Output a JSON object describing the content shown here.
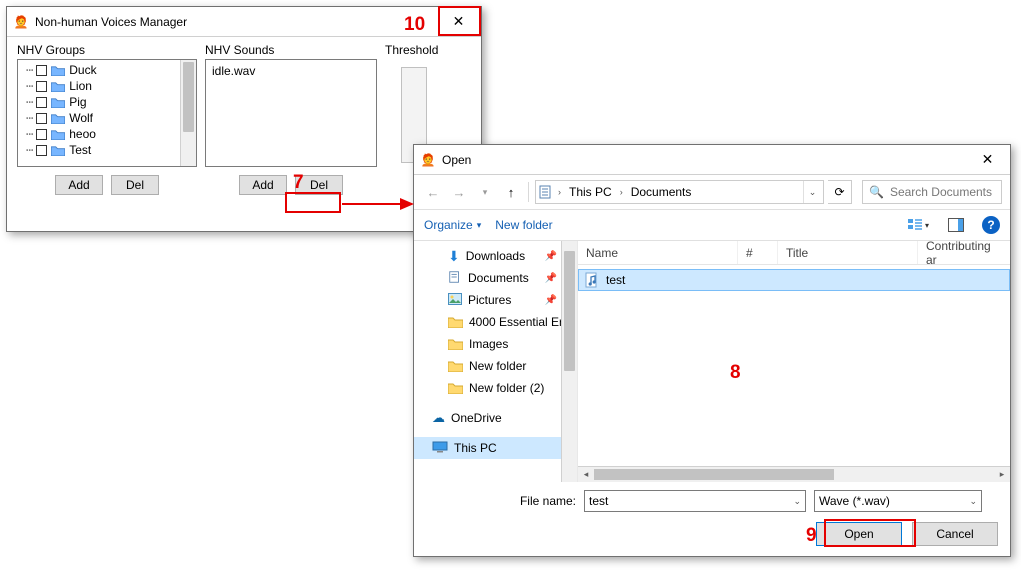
{
  "nhv": {
    "title": "Non-human Voices Manager",
    "groups_label": "NHV Groups",
    "sounds_label": "NHV Sounds",
    "threshold_label": "Threshold",
    "groups": [
      "Duck",
      "Lion",
      "Pig",
      "Wolf",
      "heoo",
      "Test"
    ],
    "sounds": [
      "idle.wav"
    ],
    "add_label": "Add",
    "del_label": "Del"
  },
  "open": {
    "title": "Open",
    "breadcrumb": {
      "seg1": "This PC",
      "seg2": "Documents"
    },
    "search_placeholder": "Search Documents",
    "organize": "Organize",
    "new_folder": "New folder",
    "columns": {
      "name": "Name",
      "num": "#",
      "title": "Title",
      "contrib": "Contributing ar"
    },
    "nav_items": {
      "downloads": "Downloads",
      "documents": "Documents",
      "pictures": "Pictures",
      "f4000": "4000 Essential Er",
      "images": "Images",
      "newfolder": "New folder",
      "newfolder2": "New folder (2)",
      "onedrive": "OneDrive",
      "thispc": "This PC"
    },
    "file": {
      "name": "test"
    },
    "filename_label": "File name:",
    "filename_value": "test",
    "filter": "Wave (*.wav)",
    "open_btn": "Open",
    "cancel_btn": "Cancel"
  },
  "annotations": {
    "n7": "7",
    "n8": "8",
    "n9": "9",
    "n10": "10"
  }
}
